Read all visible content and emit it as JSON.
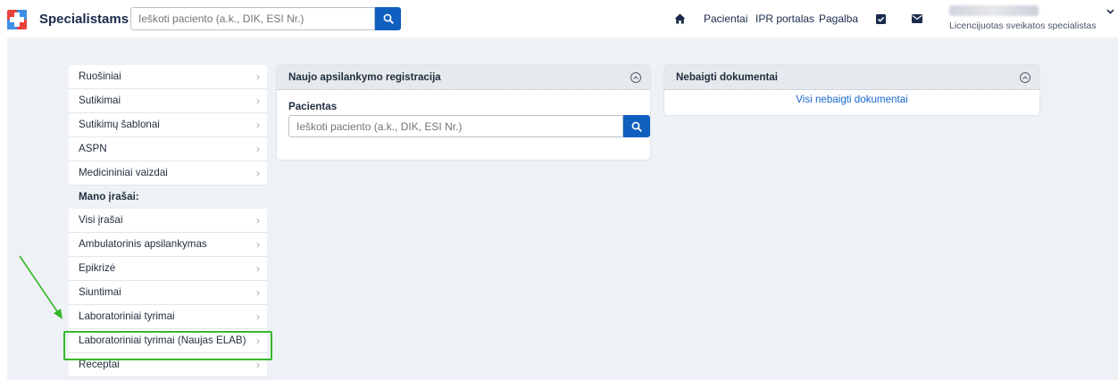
{
  "header": {
    "brand": "Specialistams",
    "search_placeholder": "Ieškoti paciento (a.k., DIK, ESI Nr.)",
    "nav": [
      "Pacientai",
      "IPR portalas",
      "Pagalba"
    ],
    "user_role": "Licencijuotas sveikatos specialistas",
    "colors": {
      "accent": "#0f5fbf",
      "logo_red": "#e9403a",
      "logo_blue": "#3f8ee6"
    }
  },
  "menu": {
    "items_top": [
      "Ruošiniai",
      "Sutikimai",
      "Sutikimų šablonai",
      "ASPN",
      "Medicininiai vaizdai"
    ],
    "section": "Mano įrašai:",
    "items_mine": [
      "Visi įrašai",
      "Ambulatorinis apsilankymas",
      "Epikrizė",
      "Siuntimai",
      "Laboratoriniai tyrimai",
      "Laboratoriniai tyrimai (Naujas ELAB)",
      "Receptai"
    ],
    "chevron": "›",
    "highlight_color": "#35b82a"
  },
  "visit_card": {
    "title": "Naujo apsilankymo registracija",
    "field_label": "Pacientas",
    "field_placeholder": "Ieškoti paciento (a.k., DIK, ESI Nr.)"
  },
  "docs_card": {
    "title": "Nebaigti dokumentai",
    "link": "Visi nebaigti dokumentai"
  }
}
